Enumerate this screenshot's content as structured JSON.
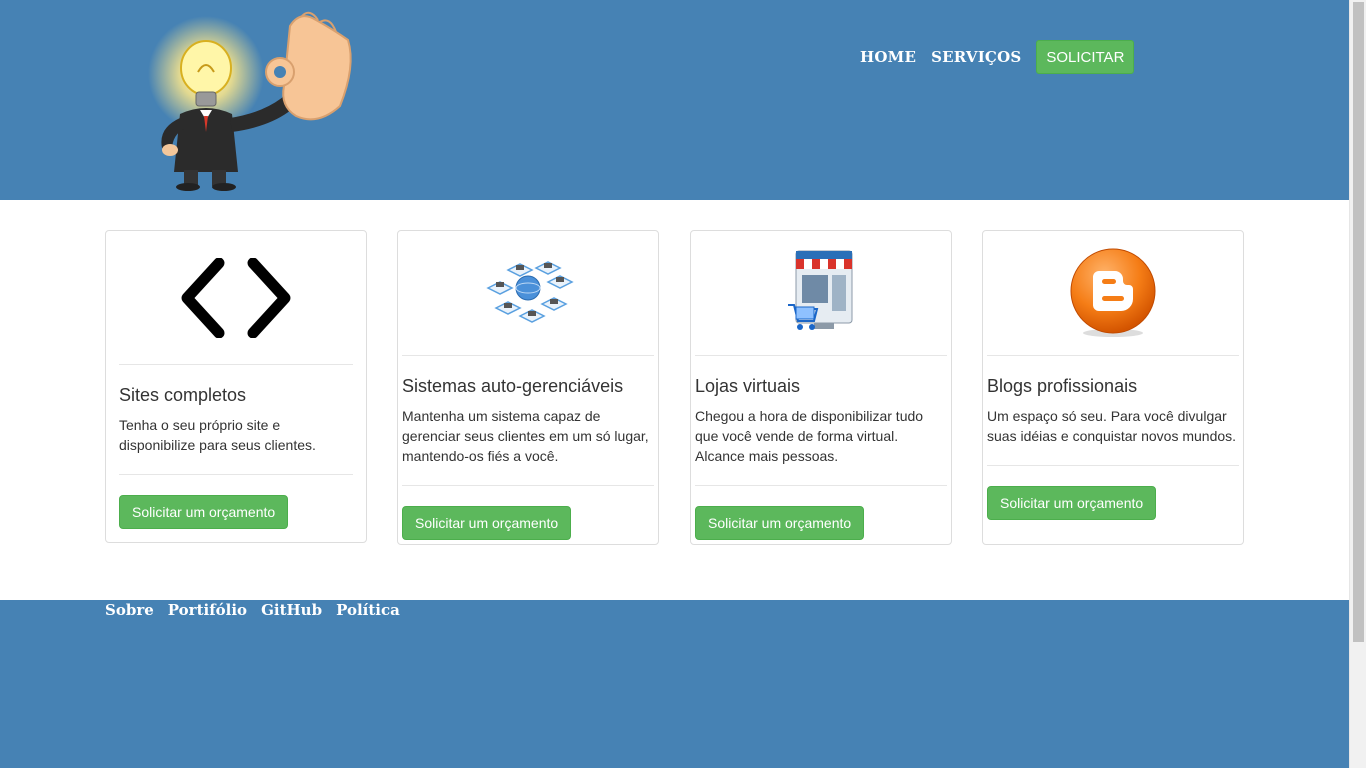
{
  "header": {
    "nav": [
      {
        "label": "HOME"
      },
      {
        "label": "SERVIÇOS"
      }
    ],
    "cta_label": "SOLICITAR"
  },
  "cards": [
    {
      "title": "Sites completos",
      "text": "Tenha o seu próprio site e disponibilize para seus clientes.",
      "button": "Solicitar um orçamento",
      "icon": "code-brackets-icon"
    },
    {
      "title": "Sistemas auto-gerenciáveis",
      "text": "Mantenha um sistema capaz de gerenciar seus clientes em um só lugar, mantendo-os fiés a você.",
      "button": "Solicitar um orçamento",
      "icon": "network-icon"
    },
    {
      "title": "Lojas virtuais",
      "text": "Chegou a hora de disponibilizar tudo que você vende de forma virtual. Alcance mais pessoas.",
      "button": "Solicitar um orçamento",
      "icon": "online-store-icon"
    },
    {
      "title": "Blogs profissionais",
      "text": "Um espaço só seu. Para você divulgar suas idéias e conquistar novos mundos.",
      "button": "Solicitar um orçamento",
      "icon": "blogger-icon"
    }
  ],
  "footer": {
    "links": [
      "Sobre",
      "Portifólio",
      "GitHub",
      "Política"
    ]
  },
  "colors": {
    "brand_blue": "#4682b4",
    "button_green": "#5cb85c"
  }
}
